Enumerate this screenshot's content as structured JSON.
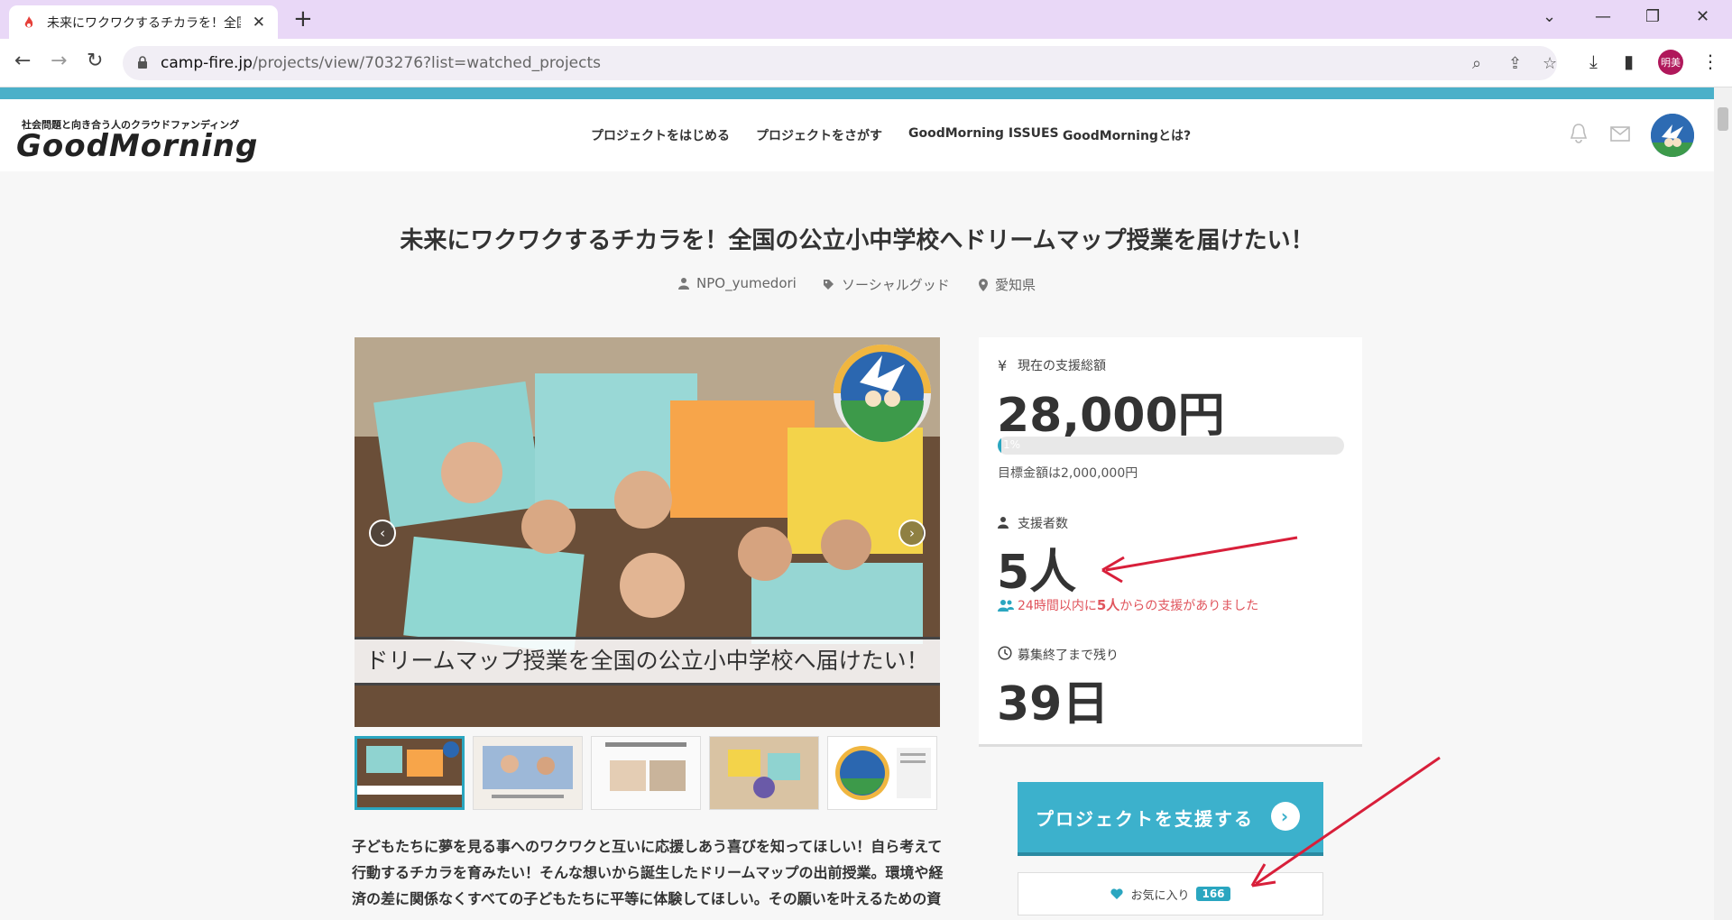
{
  "browser": {
    "tab_title": "未来にワクワクするチカラを！全国の",
    "url_domain": "camp-fire.jp",
    "url_path": "/projects/view/703276?list=watched_projects",
    "profile_initials": "明美"
  },
  "site": {
    "logo_tagline": "社会問題と向き合う人のクラウドファンディング",
    "logo_name": "GoodMorning",
    "nav": [
      {
        "label": "プロジェクトをはじめる"
      },
      {
        "label": "プロジェクトをさがす"
      },
      {
        "label": "GoodMorning ISSUES"
      },
      {
        "label": "GoodMorningとは?"
      }
    ],
    "accent_color": "#4bb0c9"
  },
  "project": {
    "title": "未来にワクワクするチカラを！全国の公立小中学校へドリームマップ授業を届けたい！",
    "owner": "NPO_yumedori",
    "category": "ソーシャルグッド",
    "location": "愛知県",
    "hero_caption": "ドリームマップ授業を全国の公立小中学校へ届けたい！",
    "description": "子どもたちに夢を見る事へのワクワクと互いに応援しあう喜びを知ってほしい！自ら考えて行動するチカラを育みたい！そんな想いから誕生したドリームマップの出前授業。環境や経済の差に関係なくすべての子どもたちに平等に体験してほしい。その願いを叶えるための資"
  },
  "stats": {
    "total_label": "現在の支援総額",
    "total_amount": "28,000円",
    "progress_percent": 1,
    "progress_text": "1%",
    "goal_text": "目標金額は2,000,000円",
    "supporters_label": "支援者数",
    "supporters_count": "5人",
    "recent_prefix": "24時間以内に",
    "recent_count": "5人",
    "recent_suffix": "からの支援がありました",
    "remaining_label": "募集終了まで残り",
    "remaining_days": "39日"
  },
  "actions": {
    "support_label": "プロジェクトを支援する",
    "favorite_label": "お気に入り",
    "favorite_count": "166"
  }
}
